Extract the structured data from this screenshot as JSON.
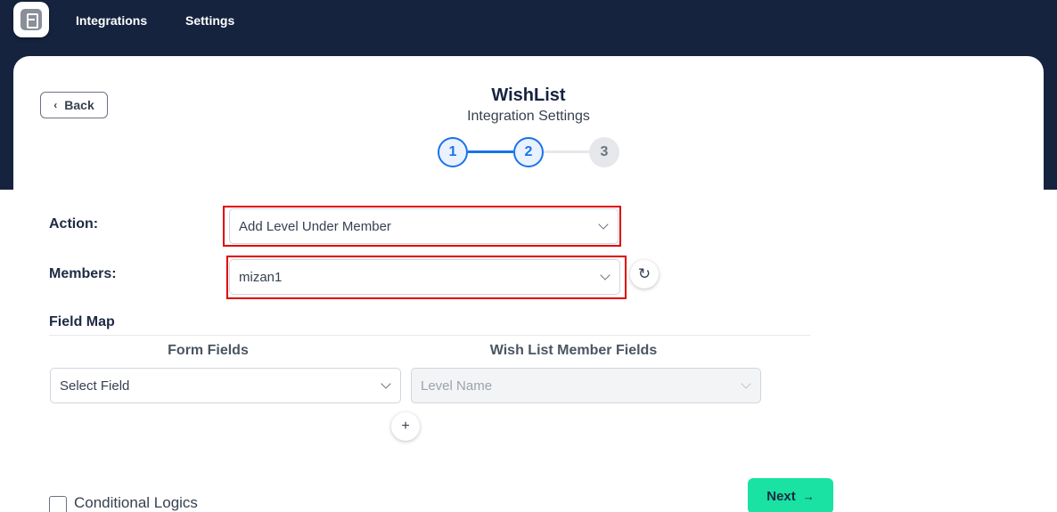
{
  "nav": {
    "logo_icon": "app-logo-icon",
    "integrations_label": "Integrations",
    "settings_label": "Settings"
  },
  "header": {
    "back_label": "Back",
    "title": "WishList",
    "subtitle": "Integration Settings"
  },
  "steps": [
    {
      "label": "1",
      "state": "completed"
    },
    {
      "label": "2",
      "state": "active"
    },
    {
      "label": "3",
      "state": "pending"
    }
  ],
  "form": {
    "action_label": "Action:",
    "action_value": "Add Level Under Member",
    "members_label": "Members:",
    "members_value": "mizan1",
    "refresh_icon": "↻"
  },
  "field_map": {
    "title": "Field Map",
    "form_fields_header": "Form Fields",
    "wishlist_fields_header": "Wish List Member Fields",
    "form_field_value": "Select Field",
    "wishlist_field_value": "Level Name",
    "add_icon": "+"
  },
  "footer": {
    "conditional_label": "Conditional Logics",
    "next_label": "Next",
    "next_icon": "→"
  },
  "colors": {
    "topbar": "#16233f",
    "accent_blue": "#1a73e8",
    "highlight_red": "#e00000",
    "next_green": "#19e2a2"
  }
}
